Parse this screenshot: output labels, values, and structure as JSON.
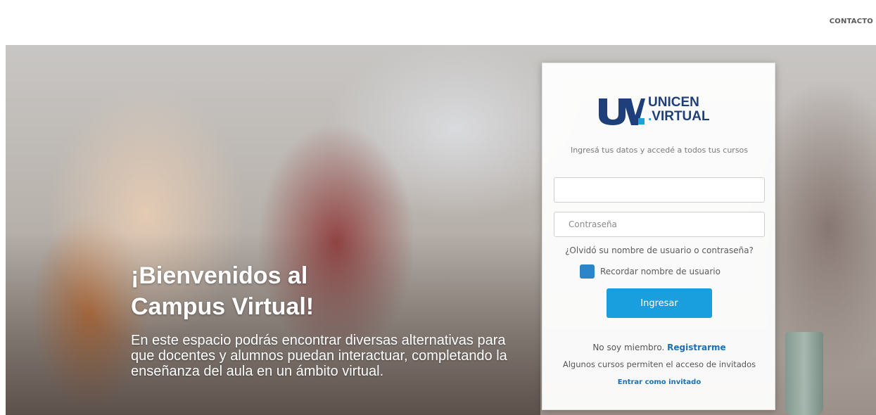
{
  "header": {
    "contact_label": "CONTACTO"
  },
  "hero": {
    "title": "¡Bienvenidos al Campus Virtual!",
    "text": "En este espacio podrás encontrar diversas alternativas para que docentes y alumnos puedan interactuar, completando la enseñanza del aula en un ámbito virtual."
  },
  "logo": {
    "line1": "UNICEN",
    "dot": ".",
    "line2": "VIRTUAL"
  },
  "login": {
    "intro": "Ingresá tus datos y accedé a todos tus cursos",
    "username_value": "",
    "username_placeholder": "",
    "password_placeholder": "Contraseña",
    "forgot_link": "¿Olvidó su nombre de usuario o contraseña?",
    "remember_label": "Recordar nombre de usuario",
    "submit_label": "Ingresar",
    "signup_text": "No soy miembro.",
    "signup_link": "Registrarme",
    "guest_info": "Algunos cursos permiten el acceso de invitados",
    "guest_link": "Entrar como invitado"
  },
  "colors": {
    "primary": "#1a9fde",
    "brand_navy": "#1f3f7a",
    "checkbox": "#2c85c8"
  }
}
